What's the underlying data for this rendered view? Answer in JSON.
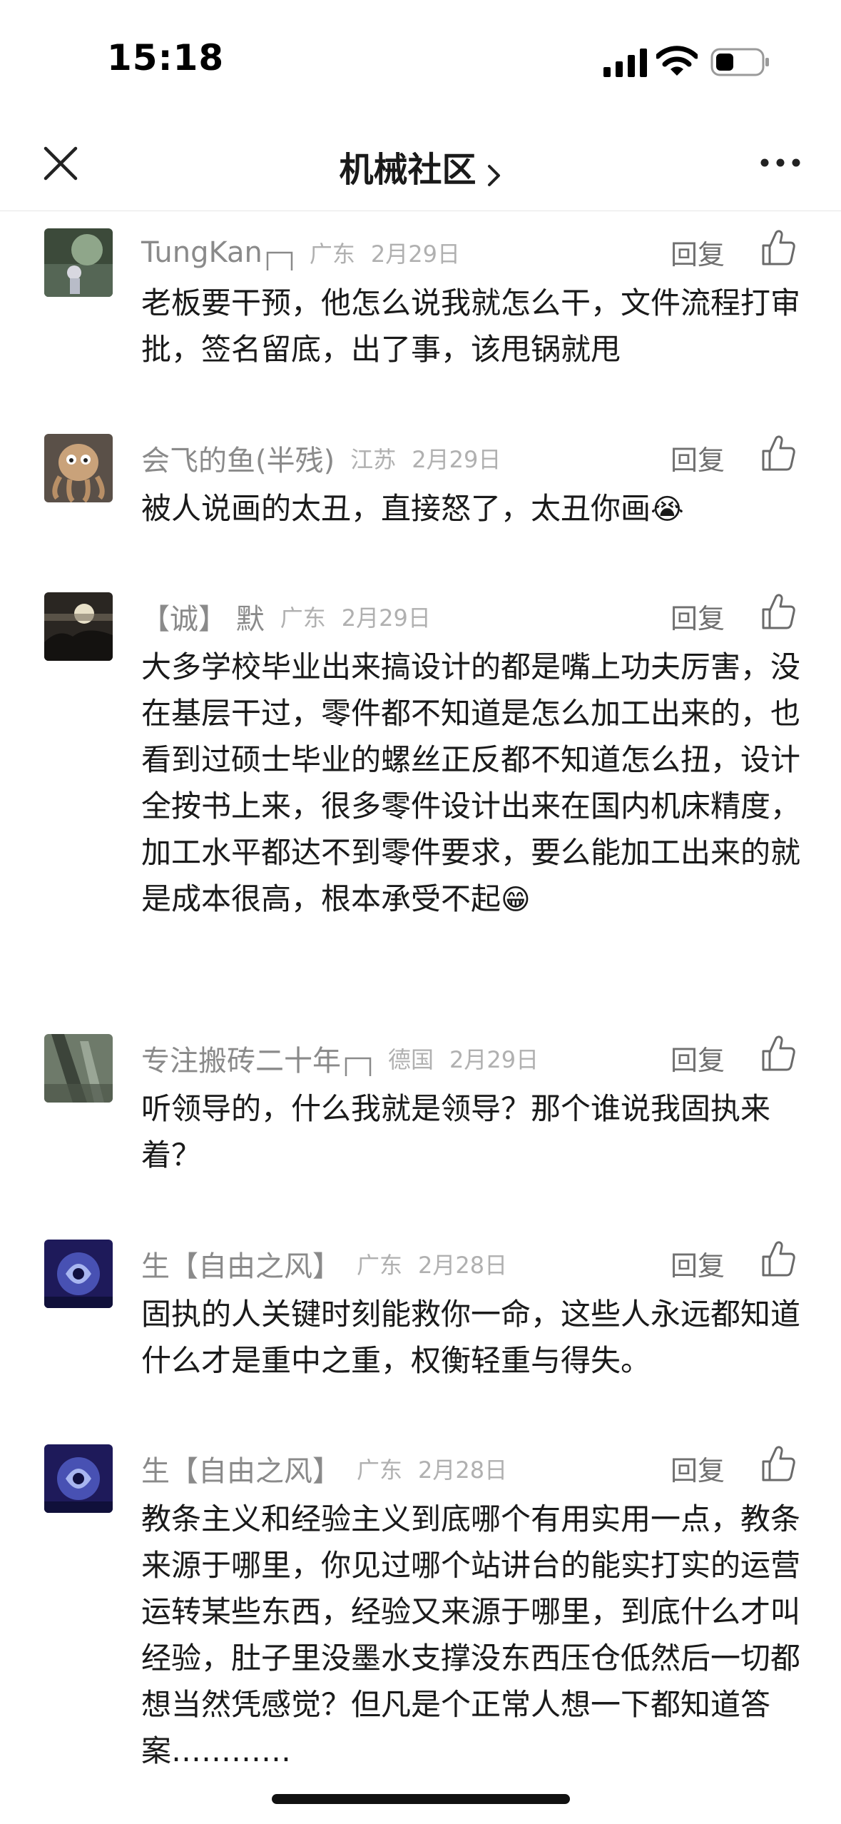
{
  "status_bar": {
    "time": "15:18"
  },
  "nav": {
    "title": "机械社区"
  },
  "comments": [
    {
      "username": "TungKan",
      "region": "广东",
      "date": "2月29日",
      "reply_label": "回复",
      "body": "老板要干预，他怎么说我就怎么干，文件流程打审批，签名留底，出了事，该甩锅就甩",
      "emoji": ""
    },
    {
      "username": "会飞的鱼(半残)",
      "region": "江苏",
      "date": "2月29日",
      "reply_label": "回复",
      "body": "被人说画的太丑，直接怒了，太丑你画",
      "emoji": "😭"
    },
    {
      "username": "【诚】 默",
      "region": "广东",
      "date": "2月29日",
      "reply_label": "回复",
      "body": "大多学校毕业出来搞设计的都是嘴上功夫厉害，没在基层干过，零件都不知道是怎么加工出来的，也看到过硕士毕业的螺丝正反都不知道怎么扭，设计全按书上来，很多零件设计出来在国内机床精度，加工水平都达不到零件要求，要么能加工出来的就是成本很高，根本承受不起",
      "emoji": "😁"
    },
    {
      "username": "专注搬砖二十年",
      "region": "德国",
      "date": "2月29日",
      "reply_label": "回复",
      "body": "听领导的，什么我就是领导？那个谁说我固执来着？",
      "emoji": ""
    },
    {
      "username": "生【自由之风】",
      "region": "广东",
      "date": "2月28日",
      "reply_label": "回复",
      "body": "固执的人关键时刻能救你一命，这些人永远都知道什么才是重中之重，权衡轻重与得失。",
      "emoji": ""
    },
    {
      "username": "生【自由之风】",
      "region": "广东",
      "date": "2月28日",
      "reply_label": "回复",
      "body": "教条主义和经验主义到底哪个有用实用一点，教条来源于哪里，你见过哪个站讲台的能实打实的运营运转某些东西，经验又来源于哪里，到底什么才叫经验，肚子里没墨水支撑没东西压仓低然后一切都想当然凭感觉？但凡是个正常人想一下都知道答案…………",
      "emoji": ""
    }
  ]
}
